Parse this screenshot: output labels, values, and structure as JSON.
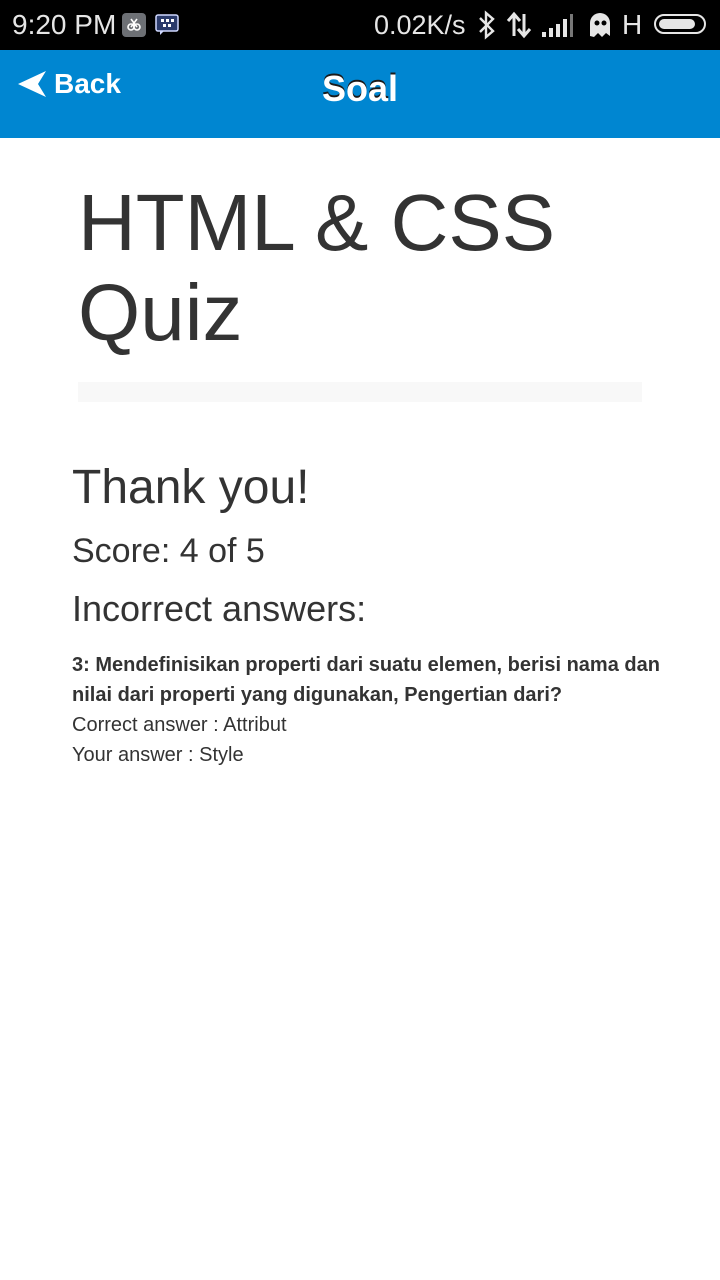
{
  "statusbar": {
    "time": "9:20 PM",
    "speed": "0.02K/s",
    "network_type": "H",
    "battery_level": 0.85,
    "icons": [
      "notification-icon",
      "bbm-icon",
      "bluetooth-icon",
      "data-arrows-icon",
      "signal-icon",
      "ghost-icon",
      "battery-icon"
    ]
  },
  "appbar": {
    "back_label": "Back",
    "title": "Soal",
    "background": "#0086d1"
  },
  "quiz": {
    "title": "HTML & CSS Quiz"
  },
  "result": {
    "thankyou": "Thank you!",
    "score": "Score: 4 of 5",
    "incorrect_heading": "Incorrect answers:",
    "items": [
      {
        "question": "3: Mendefinisikan properti dari suatu elemen, berisi nama dan nilai dari properti yang digunakan, Pengertian dari?",
        "correct": "Correct answer : Attribut",
        "yours": "Your answer : Style"
      }
    ]
  }
}
